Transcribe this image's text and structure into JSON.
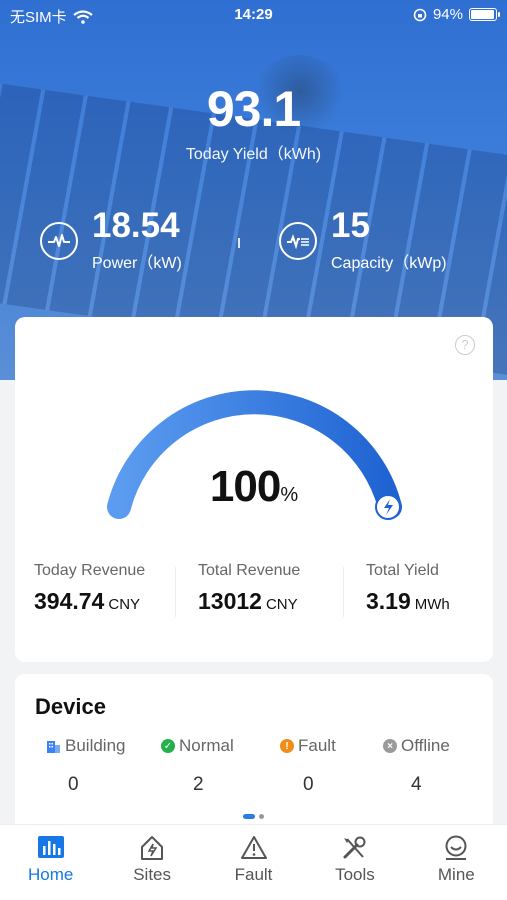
{
  "status_bar": {
    "carrier": "无SIM卡",
    "time": "14:29",
    "battery": "94%",
    "battery_level": 0.94
  },
  "summary": {
    "today_yield": "93.1",
    "today_yield_label": "Today Yield（kWh)",
    "power": "18.54",
    "power_label": "Power（kW)",
    "capacity": "15",
    "capacity_label": "Capacity（kWp)"
  },
  "gauge": {
    "percent": "100",
    "unit": "%",
    "value": 1.0,
    "help_icon": "?"
  },
  "revenue": [
    {
      "label": "Today Revenue",
      "value": "394.74",
      "unit": "CNY"
    },
    {
      "label": "Total Revenue",
      "value": "13012",
      "unit": "CNY"
    },
    {
      "label": "Total Yield",
      "value": "3.19",
      "unit": "MWh"
    }
  ],
  "device": {
    "title": "Device",
    "stats": [
      {
        "label": "Building",
        "count": "0",
        "icon": "building-icon",
        "color": "#3b82f6"
      },
      {
        "label": "Normal",
        "count": "2",
        "icon": "check-icon",
        "color": "#22b14c"
      },
      {
        "label": "Fault",
        "count": "0",
        "icon": "alert-icon",
        "color": "#f08c1a"
      },
      {
        "label": "Offline",
        "count": "4",
        "icon": "offline-icon",
        "color": "#9a9a9a"
      }
    ]
  },
  "tabs": [
    {
      "label": "Home",
      "icon": "home-chart-icon",
      "active": true
    },
    {
      "label": "Sites",
      "icon": "sites-icon",
      "active": false
    },
    {
      "label": "Fault",
      "icon": "fault-icon",
      "active": false
    },
    {
      "label": "Tools",
      "icon": "tools-icon",
      "active": false
    },
    {
      "label": "Mine",
      "icon": "user-icon",
      "active": false
    }
  ],
  "colors": {
    "accent": "#1677e5",
    "hero": "#3a7bd9"
  }
}
